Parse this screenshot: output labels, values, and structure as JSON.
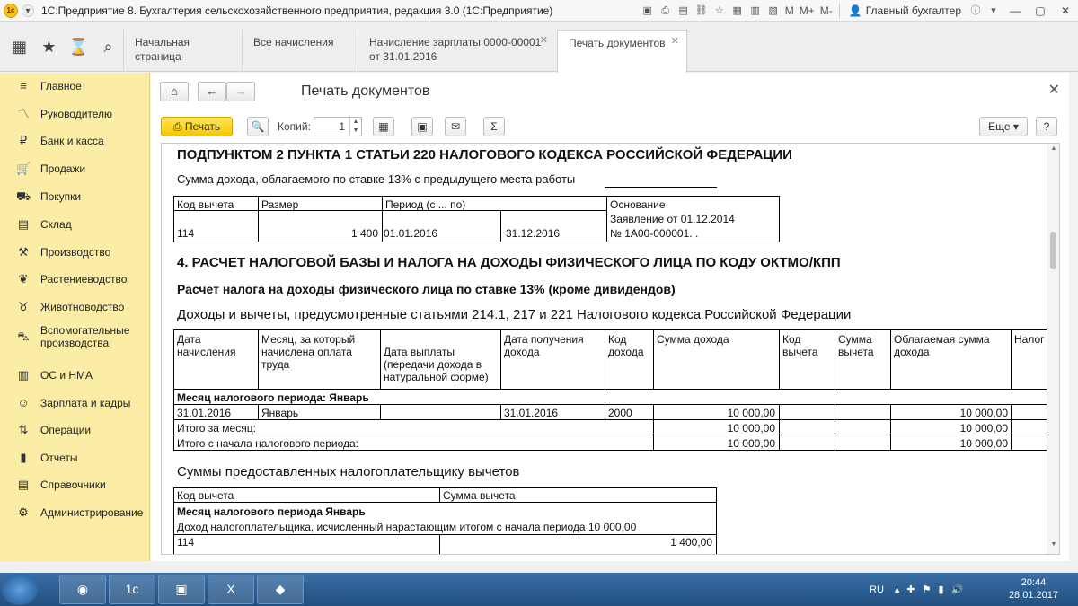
{
  "window": {
    "title": "1С:Предприятие 8. Бухгалтерия сельскохозяйственного предприятия, редакция 3.0  (1С:Предприятие)",
    "user": "Главный бухгалтер",
    "m": "M",
    "mplus": "M+",
    "mminus": "M-"
  },
  "tabs": [
    {
      "label": "Начальная страница"
    },
    {
      "label": "Все начисления"
    },
    {
      "label": "Начисление зарплаты 0000-00001 от 31.01.2016"
    },
    {
      "label": "Печать документов"
    }
  ],
  "sidebar": {
    "items": [
      {
        "label": "Главное",
        "icon": "menu-icon"
      },
      {
        "label": "Руководителю",
        "icon": "chart-icon"
      },
      {
        "label": "Банк и касса",
        "icon": "ruble-icon"
      },
      {
        "label": "Продажи",
        "icon": "cart-icon"
      },
      {
        "label": "Покупки",
        "icon": "basket-icon"
      },
      {
        "label": "Склад",
        "icon": "warehouse-icon"
      },
      {
        "label": "Производство",
        "icon": "factory-icon"
      },
      {
        "label": "Растениеводство",
        "icon": "leaf-icon"
      },
      {
        "label": "Животноводство",
        "icon": "cow-icon"
      },
      {
        "label": "Вспомогательные производства",
        "icon": "tractor-icon"
      },
      {
        "label": "ОС и НМА",
        "icon": "building-icon"
      },
      {
        "label": "Зарплата и кадры",
        "icon": "people-icon"
      },
      {
        "label": "Операции",
        "icon": "operations-icon"
      },
      {
        "label": "Отчеты",
        "icon": "bar-chart-icon"
      },
      {
        "label": "Справочники",
        "icon": "book-icon"
      },
      {
        "label": "Администрирование",
        "icon": "gear-icon"
      }
    ]
  },
  "main": {
    "title": "Печать документов",
    "print_label": "Печать",
    "copies_label": "Копий:",
    "copies_value": "1",
    "more_label": "Еще",
    "help_label": "?"
  },
  "doc": {
    "heading_top": "ПОДПУНКТОМ 2 ПУНКТА 1 СТАТЬИ 220 НАЛОГОВОГО КОДЕКСА РОССИЙСКОЙ ФЕДЕРАЦИИ",
    "income_prev": "Сумма дохода, облагаемого по ставке 13% с предыдущего места работы",
    "t1": {
      "headers": [
        "Код вычета",
        "Размер",
        "Период (с ... по)",
        "Основание"
      ],
      "row": {
        "code": "114",
        "amount": "1 400",
        "from": "01.01.2016",
        "to": "31.12.2016",
        "basis1": "Заявление от 01.12.2014",
        "basis2": "№ 1А00-000001. ."
      }
    },
    "section4": "4. РАСЧЕТ НАЛОГОВОЙ БАЗЫ И НАЛОГА НА ДОХОДЫ ФИЗИЧЕСКОГО ЛИЦА ПО КОДУ ОКТМО/КПП",
    "calc_title": "Расчет налога на доходы физического лица по ставке 13% (кроме дивидендов)",
    "income_heading": "Доходы и вычеты, предусмотренные статьями 214.1, 217 и 221 Налогового кодекса Российской Федерации",
    "t2": {
      "h_date1": "Дата",
      "h_date2": "начисления",
      "h_month1": "Месяц, за который",
      "h_month2": "начислена оплата",
      "h_month3": "труда",
      "h_pay1": "Дата выплаты",
      "h_pay2": "(передачи дохода в",
      "h_pay3": "натуральной форме)",
      "h_recv1": "Дата получения",
      "h_recv2": "дохода",
      "h_code1": "Код",
      "h_code2": "дохода",
      "h_sum": "Сумма дохода",
      "h_ded1": "Код",
      "h_ded2": "вычета",
      "h_dsum1": "Сумма",
      "h_dsum2": "вычета",
      "h_tax1": "Облагаемая сумма",
      "h_tax2": "дохода",
      "h_last": "Налог",
      "month_group": "Месяц налогового периода: Январь",
      "row_date": "31.01.2016",
      "row_month": "Январь",
      "row_recv": "31.01.2016",
      "row_code": "2000",
      "row_sum": "10 000,00",
      "row_taxable": "10 000,00",
      "total_month": "Итого за месяц:",
      "total_month_sum": "10 000,00",
      "total_month_taxable": "10 000,00",
      "total_period": "Итого с начала налогового периода:",
      "total_period_sum": "10 000,00",
      "total_period_taxable": "10 000,00"
    },
    "deductions_heading": "Суммы предоставленных налогоплательщику вычетов",
    "t3": {
      "h_code": "Код вычета",
      "h_sum": "Сумма вычета",
      "month_group": "Месяц налогового периода Январь",
      "income_line": "Доход налогоплательщика, исчисленный нарастающим итогом с начала периода 10 000,00",
      "row_code": "114",
      "row_sum": "1 400,00"
    }
  },
  "taskbar": {
    "lang": "RU",
    "time": "20:44",
    "date": "28.01.2017"
  }
}
